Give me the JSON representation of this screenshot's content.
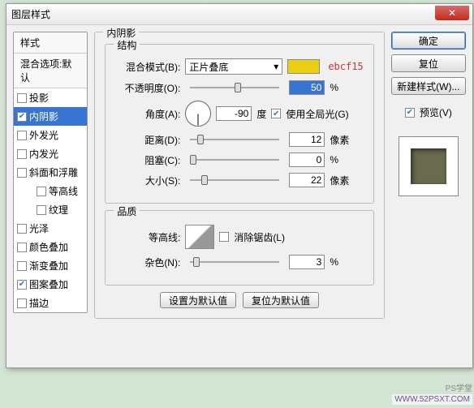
{
  "dialog": {
    "title": "图层样式"
  },
  "left": {
    "styles_header": "样式",
    "blend_opts": "混合选项:默认",
    "items": [
      {
        "label": "投影",
        "checked": false,
        "selected": false
      },
      {
        "label": "内阴影",
        "checked": true,
        "selected": true
      },
      {
        "label": "外发光",
        "checked": false,
        "selected": false
      },
      {
        "label": "内发光",
        "checked": false,
        "selected": false
      },
      {
        "label": "斜面和浮雕",
        "checked": false,
        "selected": false
      },
      {
        "label": "等高线",
        "checked": false,
        "selected": false,
        "indented": true
      },
      {
        "label": "纹理",
        "checked": false,
        "selected": false,
        "indented": true
      },
      {
        "label": "光泽",
        "checked": false,
        "selected": false
      },
      {
        "label": "颜色叠加",
        "checked": false,
        "selected": false
      },
      {
        "label": "渐变叠加",
        "checked": false,
        "selected": false
      },
      {
        "label": "图案叠加",
        "checked": true,
        "selected": false
      },
      {
        "label": "描边",
        "checked": false,
        "selected": false
      }
    ]
  },
  "center": {
    "panel_title": "内阴影",
    "group_struct": "结构",
    "blend_mode_label": "混合模式(B):",
    "blend_mode_value": "正片叠底",
    "color_hex": "ebcf15",
    "opacity_label": "不透明度(O):",
    "opacity_value": "50",
    "opacity_unit": "%",
    "angle_label": "角度(A):",
    "angle_value": "-90",
    "angle_unit": "度",
    "global_light_label": "使用全局光(G)",
    "global_light_checked": true,
    "distance_label": "距离(D):",
    "distance_value": "12",
    "distance_unit": "像素",
    "choke_label": "阻塞(C):",
    "choke_value": "0",
    "choke_unit": "%",
    "size_label": "大小(S):",
    "size_value": "22",
    "size_unit": "像素",
    "group_quality": "品质",
    "contour_label": "等高线:",
    "antialias_label": "消除锯齿(L)",
    "antialias_checked": false,
    "noise_label": "杂色(N):",
    "noise_value": "3",
    "noise_unit": "%",
    "btn_set_default": "设置为默认值",
    "btn_reset_default": "复位为默认值"
  },
  "right": {
    "ok": "确定",
    "cancel": "复位",
    "new_style": "新建样式(W)...",
    "preview_label": "预览(V)",
    "preview_checked": true
  },
  "watermark": {
    "text1": "PS学堂",
    "text2": "WWW.52PSXT.COM"
  }
}
